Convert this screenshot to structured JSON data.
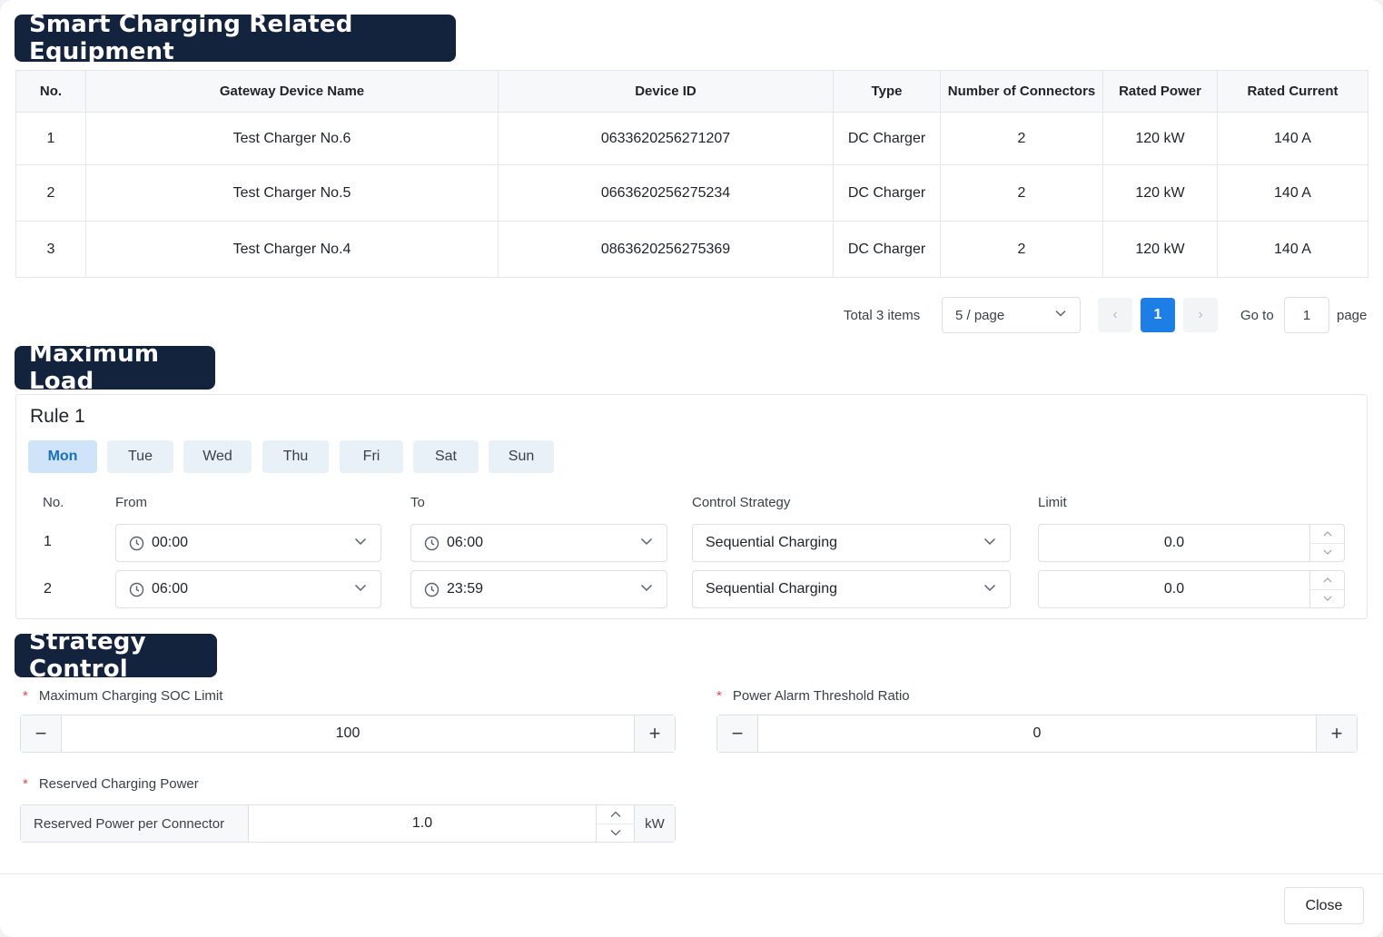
{
  "equipment": {
    "title": "Smart Charging Related Equipment",
    "columns": [
      "No.",
      "Gateway Device Name",
      "Device ID",
      "Type",
      "Number of Connectors",
      "Rated Power",
      "Rated Current"
    ],
    "rows": [
      [
        "1",
        "Test Charger No.6",
        "0633620256271207",
        "DC Charger",
        "2",
        "120 kW",
        "140 A"
      ],
      [
        "2",
        "Test Charger No.5",
        "0663620256275234",
        "DC Charger",
        "2",
        "120 kW",
        "140 A"
      ],
      [
        "3",
        "Test Charger No.4",
        "0863620256275369",
        "DC Charger",
        "2",
        "120 kW",
        "140 A"
      ]
    ]
  },
  "pagination": {
    "total": "Total 3 items",
    "page_size": "5 / page",
    "current_page": "1",
    "prev_symbol": "‹",
    "next_symbol": "›",
    "goto_label": "Go to",
    "goto_value": "1",
    "goto_suffix": "page"
  },
  "max_load": {
    "title": "Maximum Load",
    "rule_title": "Rule 1",
    "days": [
      "Mon",
      "Tue",
      "Wed",
      "Thu",
      "Fri",
      "Sat",
      "Sun"
    ],
    "active_day": "Mon",
    "columns": {
      "no": "No.",
      "from": "From",
      "to": "To",
      "strategy": "Control Strategy",
      "limit": "Limit"
    },
    "rows": [
      {
        "no": "1",
        "from": "00:00",
        "to": "06:00",
        "strategy": "Sequential Charging",
        "limit": "0.0"
      },
      {
        "no": "2",
        "from": "06:00",
        "to": "23:59",
        "strategy": "Sequential Charging",
        "limit": "0.0"
      }
    ]
  },
  "strategy": {
    "title": "Strategy Control",
    "required_mark": "*",
    "soc_label": "Maximum Charging SOC Limit",
    "soc_value": "100",
    "alarm_label": "Power Alarm Threshold Ratio",
    "alarm_value": "0",
    "reserved_label": "Reserved Charging Power",
    "reserved_prefix": "Reserved Power per Connector",
    "reserved_value": "1.0",
    "reserved_unit": "kW",
    "minus_symbol": "−",
    "plus_symbol": "+"
  },
  "footer": {
    "close_label": "Close"
  },
  "colors": {
    "primary": "#1d7fe6",
    "title_bg": "#14233d",
    "required": "#e5484d",
    "active_day_bg": "#cfe4f8"
  }
}
